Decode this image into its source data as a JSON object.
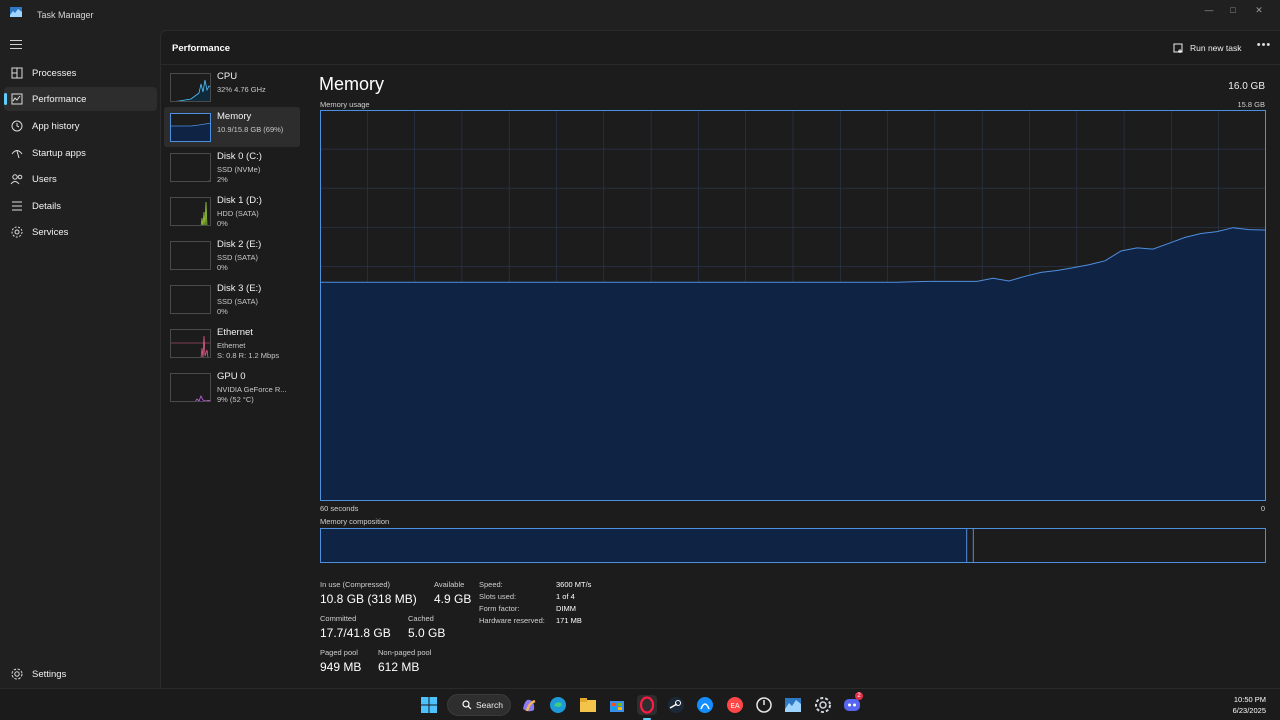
{
  "window": {
    "title": "Task Manager"
  },
  "nav": {
    "items": [
      {
        "label": "Processes",
        "icon": "processes-icon"
      },
      {
        "label": "Performance",
        "icon": "performance-icon",
        "active": true
      },
      {
        "label": "App history",
        "icon": "app-history-icon"
      },
      {
        "label": "Startup apps",
        "icon": "startup-icon"
      },
      {
        "label": "Users",
        "icon": "users-icon"
      },
      {
        "label": "Details",
        "icon": "details-icon"
      },
      {
        "label": "Services",
        "icon": "services-icon"
      }
    ],
    "settings_label": "Settings"
  },
  "header": {
    "title": "Performance",
    "run_new_task": "Run new task"
  },
  "resources": [
    {
      "name": "CPU",
      "sub1": "32% 4.76 GHz",
      "sub2": "",
      "color": "#4cc2ff"
    },
    {
      "name": "Memory",
      "sub1": "10.9/15.8 GB (69%)",
      "sub2": "",
      "color": "#4f8fe0",
      "selected": true
    },
    {
      "name": "Disk 0 (C:)",
      "sub1": "SSD (NVMe)",
      "sub2": "2%",
      "color": "#9ccc3c"
    },
    {
      "name": "Disk 1 (D:)",
      "sub1": "HDD (SATA)",
      "sub2": "0%",
      "color": "#9ccc3c"
    },
    {
      "name": "Disk 2 (E:)",
      "sub1": "SSD (SATA)",
      "sub2": "0%",
      "color": "#9ccc3c"
    },
    {
      "name": "Disk 3 (E:)",
      "sub1": "SSD (SATA)",
      "sub2": "0%",
      "color": "#9ccc3c"
    },
    {
      "name": "Ethernet",
      "sub1": "Ethernet",
      "sub2": "S: 0.8 R: 1.2 Mbps",
      "color": "#e05b8a"
    },
    {
      "name": "GPU 0",
      "sub1": "NVIDIA GeForce R...",
      "sub2": "9% (52 °C)",
      "color": "#c068d8"
    }
  ],
  "memory": {
    "title": "Memory",
    "total": "16.0 GB",
    "usage_label": "Memory usage",
    "usage_max": "15.8 GB",
    "axis_left": "60 seconds",
    "axis_right": "0",
    "composition_label": "Memory composition",
    "stats": {
      "in_use_label": "In use (Compressed)",
      "in_use_value": "10.8 GB (318 MB)",
      "available_label": "Available",
      "available_value": "4.9 GB",
      "committed_label": "Committed",
      "committed_value": "17.7/41.8 GB",
      "cached_label": "Cached",
      "cached_value": "5.0 GB",
      "paged_label": "Paged pool",
      "paged_value": "949 MB",
      "nonpaged_label": "Non-paged pool",
      "nonpaged_value": "612 MB"
    },
    "specs": [
      {
        "label": "Speed:",
        "value": "3600 MT/s"
      },
      {
        "label": "Slots used:",
        "value": "1 of 4"
      },
      {
        "label": "Form factor:",
        "value": "DIMM"
      },
      {
        "label": "Hardware reserved:",
        "value": "171 MB"
      }
    ],
    "composition": {
      "in_use_fraction": 0.684,
      "modified_fraction": 0.007,
      "standby_fraction": 0.309
    },
    "usage_history_fraction": [
      0.56,
      0.56,
      0.56,
      0.56,
      0.56,
      0.56,
      0.56,
      0.56,
      0.56,
      0.56,
      0.56,
      0.56,
      0.56,
      0.56,
      0.56,
      0.56,
      0.56,
      0.56,
      0.56,
      0.56,
      0.56,
      0.56,
      0.56,
      0.56,
      0.56,
      0.56,
      0.56,
      0.56,
      0.56,
      0.56,
      0.56,
      0.56,
      0.56,
      0.56,
      0.56,
      0.56,
      0.56,
      0.561,
      0.562,
      0.562,
      0.562,
      0.562,
      0.57,
      0.563,
      0.575,
      0.585,
      0.59,
      0.597,
      0.605,
      0.615,
      0.64,
      0.648,
      0.645,
      0.66,
      0.675,
      0.685,
      0.69,
      0.7,
      0.695,
      0.694
    ]
  },
  "colors": {
    "accent": "#60cdff",
    "memory_line": "#4f8fe0",
    "memory_fill": "#0f2344",
    "grid": "#2c3a52"
  },
  "taskbar": {
    "search_label": "Search",
    "time": "10:50 PM",
    "date": "6/23/2025",
    "discord_badge": "2"
  }
}
